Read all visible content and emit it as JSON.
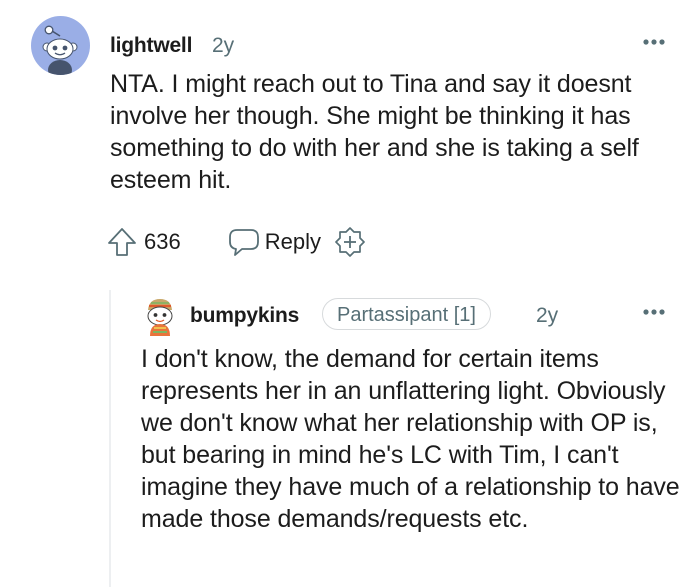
{
  "comment": {
    "author": "lightwell",
    "time": "2y",
    "avatar_icon": "snoo-avatar-icon",
    "more_icon": "more-dots-icon",
    "body": "NTA. I might reach out to Tina and say it doesnt involve her though. She might be thinking it has something to do with her and she is taking a self esteem hit.",
    "score": "636",
    "upvote_icon": "upvote-arrow-icon",
    "reply_label": "Reply",
    "reply_icon": "speech-bubble-icon",
    "award_icon": "award-plus-icon"
  },
  "reply": {
    "author": "bumpykins",
    "flair": "Partassipant [1]",
    "time": "2y",
    "avatar_icon": "custom-avatar-icon",
    "more_icon": "more-dots-icon",
    "body": "I don't know, the demand for certain items represents her in an unflattering light. Obviously we don't know what her relationship with OP is, but bearing in mind he's LC with Tim, I can't imagine they have much of a relationship to have made those demands/requests etc."
  },
  "colors": {
    "avatar_bg": "#9aaee6",
    "meta_text": "#576f76",
    "body_text": "#1c1c1c",
    "thread_line": "#edeff1"
  }
}
